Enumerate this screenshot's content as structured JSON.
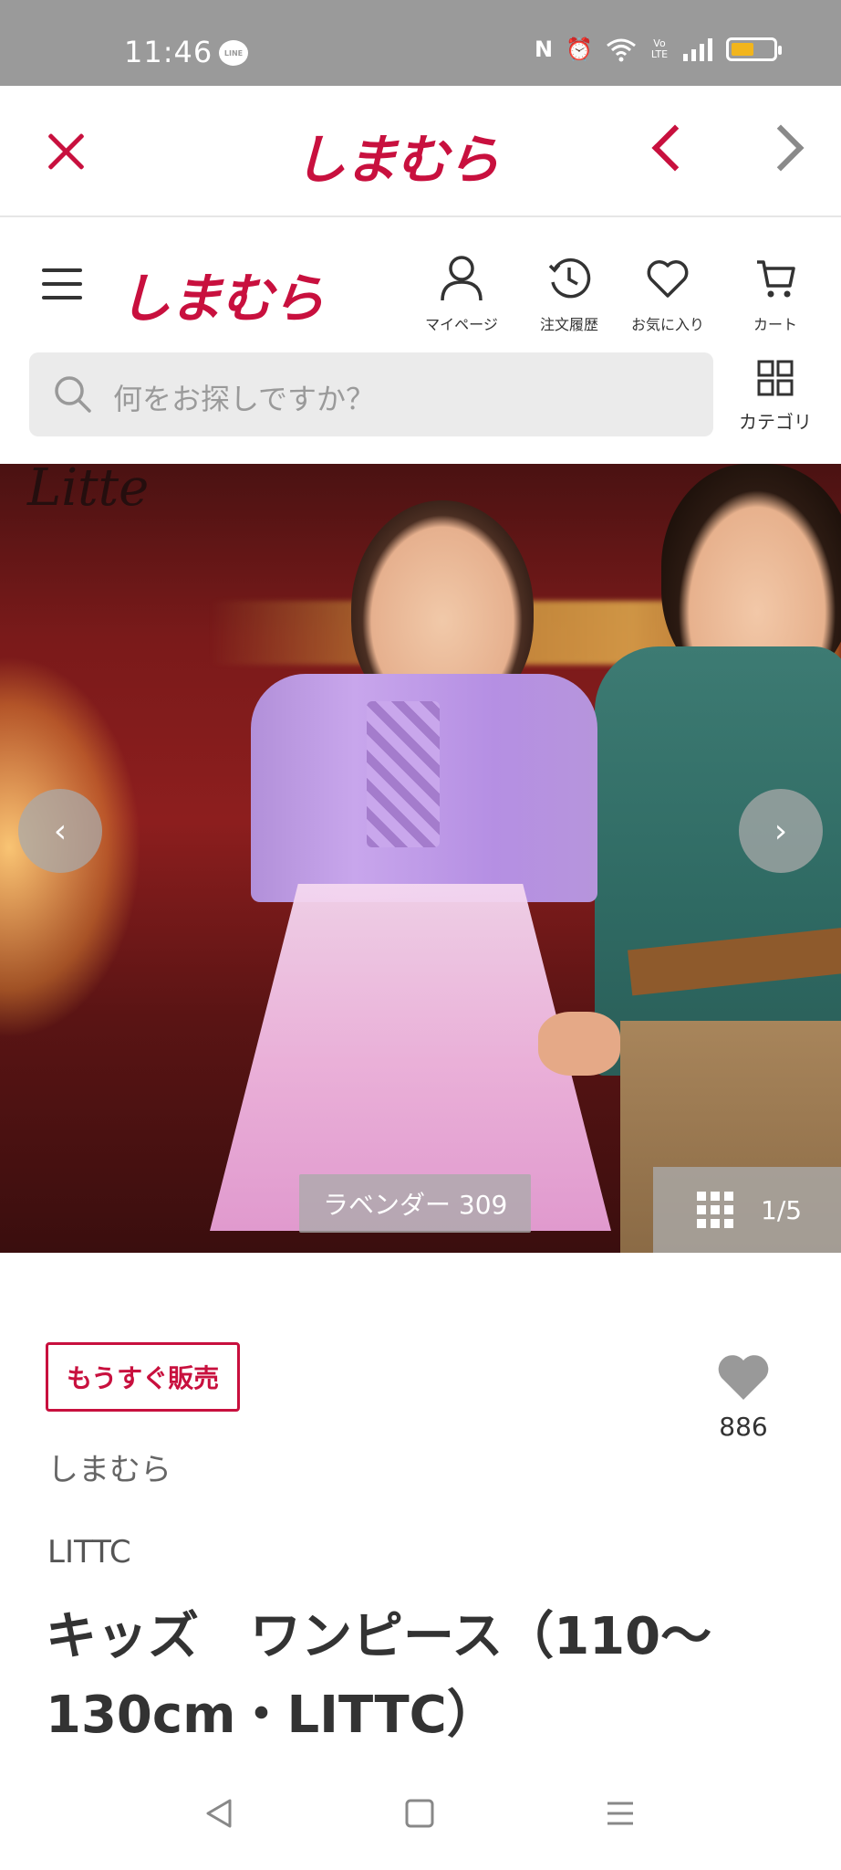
{
  "status_bar": {
    "time": "11:46",
    "line_badge": "LINE",
    "nfc": "N",
    "volte": "Vo LTE",
    "battery_level": 0.55
  },
  "top_bar": {
    "logo": "しまむら"
  },
  "header": {
    "logo": "しまむら",
    "items": [
      {
        "label": "マイページ",
        "icon": "person-icon"
      },
      {
        "label": "注文履歴",
        "icon": "clock-icon"
      },
      {
        "label": "お気に入り",
        "icon": "heart-icon"
      },
      {
        "label": "カート",
        "icon": "cart-icon"
      }
    ]
  },
  "search": {
    "placeholder": "何をお探しですか？",
    "category_label": "カテゴリ"
  },
  "hero": {
    "deco_text": "Litte",
    "color_label": "ラベンダー 309",
    "counter": "1/5",
    "prev_symbol": "‹",
    "next_symbol": "›"
  },
  "product": {
    "badge": "もうすぐ販売",
    "favorite_count": "886",
    "brand": "しまむら",
    "sub_brand": "LITTC",
    "title": "キッズ　ワンピース（110〜130cm・LITTC）"
  },
  "colors": {
    "accent": "#c8103e",
    "status_bar": "#9a9a9a",
    "battery": "#f2b51c"
  }
}
